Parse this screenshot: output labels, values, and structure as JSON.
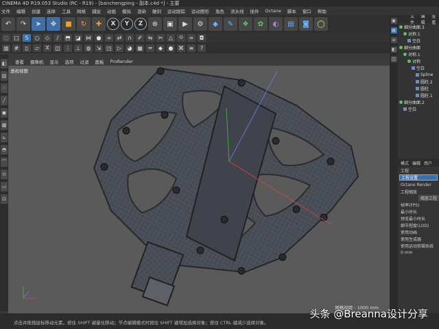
{
  "window": {
    "title": "CINEMA 4D R19.053 Studio (RC - R19) - [banchengping - 副本.c4d *] - 主要"
  },
  "menu": {
    "items": [
      "文件",
      "编辑",
      "创建",
      "选择",
      "工具",
      "网格",
      "捕捉",
      "动画",
      "模拟",
      "渲染",
      "雕刻",
      "运动跟踪",
      "运动图形",
      "角色",
      "流水线",
      "插件",
      "Octane",
      "脚本",
      "窗口",
      "帮助"
    ]
  },
  "toolbar": {
    "axes": [
      "X",
      "Y",
      "Z"
    ],
    "icons": [
      "undo-icon",
      "cursor-icon",
      "move-icon",
      "scale-icon",
      "rotate-icon",
      "add-icon",
      "axis-x-icon",
      "axis-y-icon",
      "axis-z-icon",
      "coordinate-icon",
      "render-region-icon",
      "render-view-icon",
      "render-settings-icon",
      "cube-icon",
      "pen-icon",
      "subdivide-icon",
      "cloner-icon",
      "deformer-icon",
      "floor-icon",
      "camera-icon",
      "light-icon"
    ]
  },
  "viewport": {
    "menu": [
      "查看",
      "摄像机",
      "显示",
      "选项",
      "过滤",
      "面板",
      "ProRender"
    ],
    "label": "透视视图",
    "grid_info": "网格间距 : 1000 mm"
  },
  "object_manager": {
    "tabs": [
      "文件",
      "编辑",
      "查看"
    ],
    "rows": [
      "细分曲面.3",
      "对称.1",
      "空白",
      "细分曲面",
      "对称.1",
      "对称",
      "空白",
      "Spline",
      "圆柱.2",
      "圆柱",
      "圆柱.1",
      "细分曲面.2",
      "空白"
    ]
  },
  "attributes": {
    "tabs": [
      "模式",
      "编辑",
      "用户"
    ],
    "section_title": "工程",
    "selected_tab": "工程设置",
    "renderer": "Octane Render",
    "rows": [
      "工程缩放",
      "帧率(FPS)",
      "最小时长",
      "预览最小时长",
      "细节程度(LOD)",
      "使用动画",
      "使用生成器",
      "使用运动剪辑系统"
    ],
    "button": "缩放工程",
    "coord": "0 mm"
  },
  "status": {
    "text": "点击并拖拽鼠标移动元素。按住 SHIFT 键量化移动；节点编辑模式时按住 SHIFT 键增加选择对象；按住 CTRL 键减少选择对象。"
  },
  "watermark": {
    "text": "头条 @Breanna设计分享"
  },
  "colors": {
    "accent": "#3e6fa8",
    "viewport_bg": "#5a5a5a",
    "mesh": "#4a4d55"
  }
}
